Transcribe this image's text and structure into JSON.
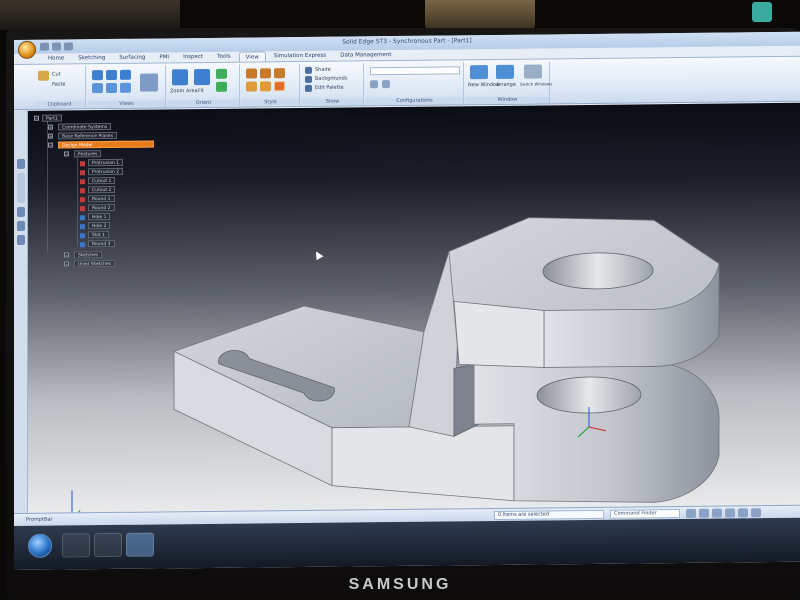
{
  "window": {
    "title": "Solid Edge ST3 - Synchronous Part - [Part1]"
  },
  "ribbon": {
    "tabs": [
      "Home",
      "Sketching",
      "Surfacing",
      "PMI",
      "Inspect",
      "Tools",
      "View",
      "Simulation Express",
      "Data Management"
    ],
    "active_tab": "View",
    "groups": [
      {
        "label": "Clipboard",
        "items": [
          "Cut",
          "Paste"
        ]
      },
      {
        "label": "Views",
        "items": [
          "Zoom Area",
          "Fit"
        ]
      },
      {
        "label": "Orient",
        "items": [
          "Sketch View"
        ]
      },
      {
        "label": "Style",
        "items": [
          "Shaded"
        ]
      },
      {
        "label": "Show",
        "items": [
          "Shade",
          "Backgrounds",
          "Edit Palette"
        ]
      },
      {
        "label": "Configurations",
        "items": []
      },
      {
        "label": "Window",
        "items": [
          "New Window",
          "Arrange",
          "Switch Windows"
        ]
      }
    ]
  },
  "pathfinder": {
    "nodes": [
      {
        "label": "Part1",
        "selected": false
      },
      {
        "label": "Coordinate Systems",
        "selected": false
      },
      {
        "label": "Base Reference Planes",
        "selected": false
      },
      {
        "label": "Design Model",
        "selected": true
      },
      {
        "label": "Features",
        "selected": false
      },
      {
        "label": "Protrusion 1",
        "selected": false
      },
      {
        "label": "Protrusion 2",
        "selected": false
      },
      {
        "label": "Cutout 1",
        "selected": false
      },
      {
        "label": "Cutout 2",
        "selected": false
      },
      {
        "label": "Round 1",
        "selected": false
      },
      {
        "label": "Round 2",
        "selected": false
      },
      {
        "label": "Hole 1",
        "selected": false
      },
      {
        "label": "Hole 2",
        "selected": false
      },
      {
        "label": "Slot 1",
        "selected": false
      },
      {
        "label": "Round 3",
        "selected": false
      },
      {
        "label": "Sketches",
        "selected": false
      },
      {
        "label": "Used Sketches",
        "selected": false
      }
    ]
  },
  "statusbar": {
    "prompt": "PromptBar",
    "message": "0 items are selected",
    "command_finder": "Command Finder"
  },
  "bezel": {
    "brand": "SAMSUNG"
  },
  "colors": {
    "selection": "#e87b1c",
    "ribbon": "#dde8f5",
    "model_face": "#c9cdd3"
  }
}
